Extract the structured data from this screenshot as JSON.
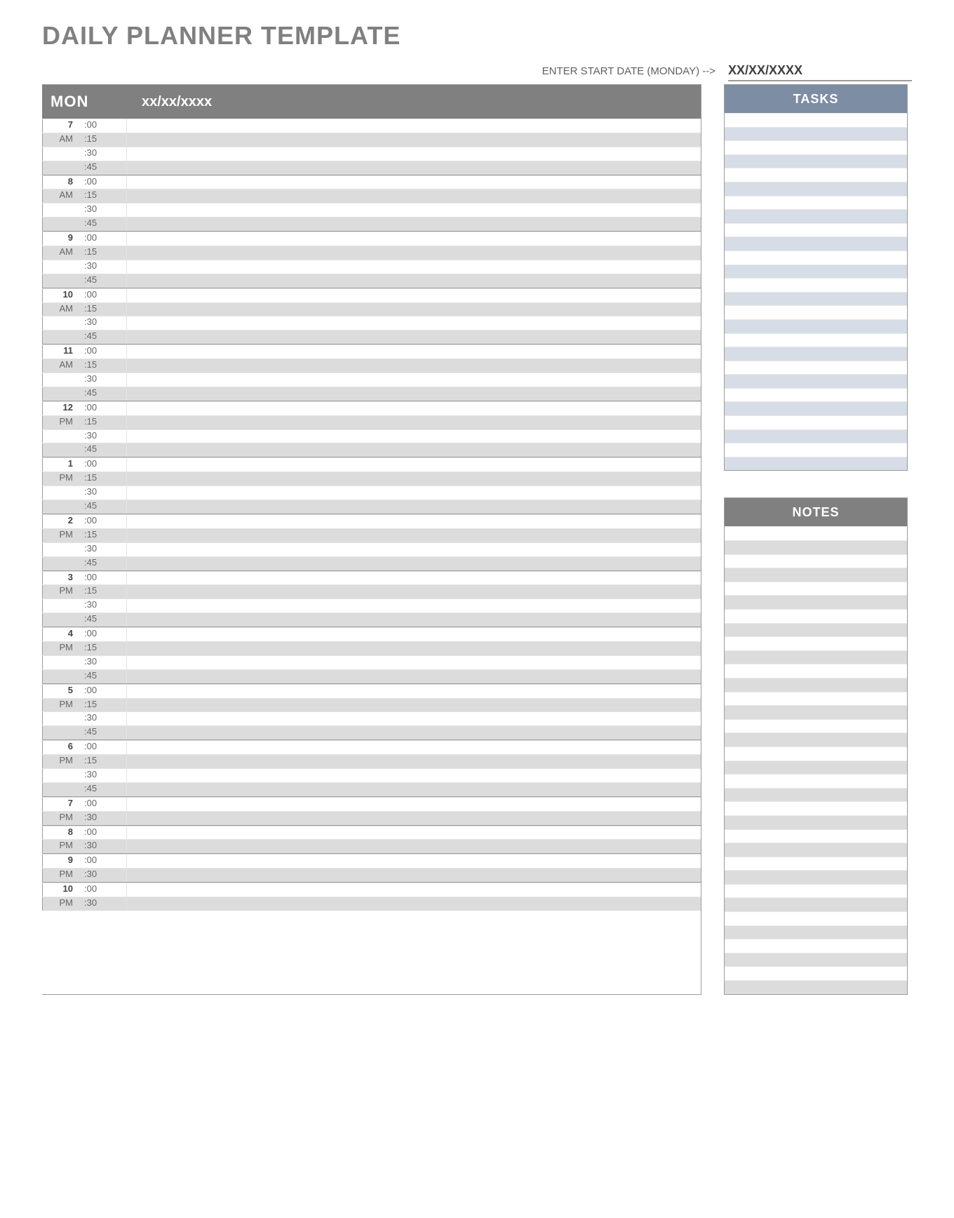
{
  "title": "DAILY PLANNER TEMPLATE",
  "startDate": {
    "label": "ENTER START DATE (MONDAY) -->",
    "value": "XX/XX/XXXX"
  },
  "schedule": {
    "day": "MON",
    "date": "xx/xx/xxxx",
    "hours": [
      {
        "hour": "7",
        "ampm": "AM",
        "slots": [
          ":00",
          ":15",
          ":30",
          ":45"
        ]
      },
      {
        "hour": "8",
        "ampm": "AM",
        "slots": [
          ":00",
          ":15",
          ":30",
          ":45"
        ]
      },
      {
        "hour": "9",
        "ampm": "AM",
        "slots": [
          ":00",
          ":15",
          ":30",
          ":45"
        ]
      },
      {
        "hour": "10",
        "ampm": "AM",
        "slots": [
          ":00",
          ":15",
          ":30",
          ":45"
        ]
      },
      {
        "hour": "11",
        "ampm": "AM",
        "slots": [
          ":00",
          ":15",
          ":30",
          ":45"
        ]
      },
      {
        "hour": "12",
        "ampm": "PM",
        "slots": [
          ":00",
          ":15",
          ":30",
          ":45"
        ]
      },
      {
        "hour": "1",
        "ampm": "PM",
        "slots": [
          ":00",
          ":15",
          ":30",
          ":45"
        ]
      },
      {
        "hour": "2",
        "ampm": "PM",
        "slots": [
          ":00",
          ":15",
          ":30",
          ":45"
        ]
      },
      {
        "hour": "3",
        "ampm": "PM",
        "slots": [
          ":00",
          ":15",
          ":30",
          ":45"
        ]
      },
      {
        "hour": "4",
        "ampm": "PM",
        "slots": [
          ":00",
          ":15",
          ":30",
          ":45"
        ]
      },
      {
        "hour": "5",
        "ampm": "PM",
        "slots": [
          ":00",
          ":15",
          ":30",
          ":45"
        ]
      },
      {
        "hour": "6",
        "ampm": "PM",
        "slots": [
          ":00",
          ":15",
          ":30",
          ":45"
        ]
      },
      {
        "hour": "7",
        "ampm": "PM",
        "slots": [
          ":00",
          ":30"
        ]
      },
      {
        "hour": "8",
        "ampm": "PM",
        "slots": [
          ":00",
          ":30"
        ]
      },
      {
        "hour": "9",
        "ampm": "PM",
        "slots": [
          ":00",
          ":30"
        ]
      },
      {
        "hour": "10",
        "ampm": "PM",
        "slots": [
          ":00",
          ":30"
        ]
      }
    ]
  },
  "tasksHeader": "TASKS",
  "notesHeader": "NOTES",
  "taskRowCount": 26,
  "noteRowCount": 34
}
